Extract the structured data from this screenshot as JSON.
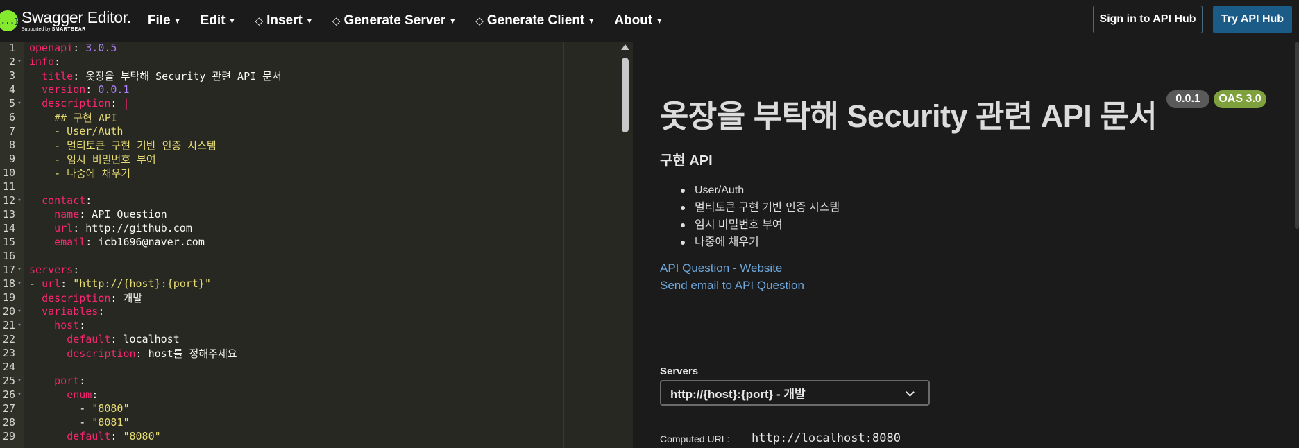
{
  "app": {
    "logo_mark": "{...}",
    "title": "Swagger Editor.",
    "supported_by": "Supported by",
    "supported_brand": "SMARTBEAR"
  },
  "menu": {
    "items": [
      {
        "label": "File",
        "gem": false
      },
      {
        "label": "Edit",
        "gem": false
      },
      {
        "label": "Insert",
        "gem": true
      },
      {
        "label": "Generate Server",
        "gem": true
      },
      {
        "label": "Generate Client",
        "gem": true
      },
      {
        "label": "About",
        "gem": false
      }
    ],
    "caret": "▾",
    "gem_glyph": "💎"
  },
  "header_buttons": {
    "sign_in": "Sign in to API Hub",
    "try": "Try API Hub"
  },
  "editor": {
    "lines": [
      {
        "n": "1",
        "fold": "",
        "tokens": [
          [
            "k",
            "openapi"
          ],
          [
            "p",
            ": "
          ],
          [
            "n",
            "3.0.5"
          ]
        ]
      },
      {
        "n": "2",
        "fold": "▾",
        "tokens": [
          [
            "k",
            "info"
          ],
          [
            "p",
            ":"
          ]
        ]
      },
      {
        "n": "3",
        "fold": "",
        "tokens": [
          [
            "p",
            "  "
          ],
          [
            "k",
            "title"
          ],
          [
            "p",
            ": 옷장을 부탁해 Security 관련 API 문서"
          ]
        ]
      },
      {
        "n": "4",
        "fold": "",
        "tokens": [
          [
            "p",
            "  "
          ],
          [
            "k",
            "version"
          ],
          [
            "p",
            ": "
          ],
          [
            "n",
            "0.0.1"
          ]
        ]
      },
      {
        "n": "5",
        "fold": "▾",
        "tokens": [
          [
            "p",
            "  "
          ],
          [
            "k",
            "description"
          ],
          [
            "p",
            ": "
          ],
          [
            "k",
            "|"
          ]
        ]
      },
      {
        "n": "6",
        "fold": "",
        "tokens": [
          [
            "s",
            "    ## 구현 API"
          ]
        ]
      },
      {
        "n": "7",
        "fold": "",
        "tokens": [
          [
            "s",
            "    - User/Auth"
          ]
        ]
      },
      {
        "n": "8",
        "fold": "",
        "tokens": [
          [
            "s",
            "    - 멀티토큰 구현 기반 인증 시스템"
          ]
        ]
      },
      {
        "n": "9",
        "fold": "",
        "tokens": [
          [
            "s",
            "    - 임시 비밀번호 부여"
          ]
        ]
      },
      {
        "n": "10",
        "fold": "",
        "tokens": [
          [
            "s",
            "    - 나중에 채우기"
          ]
        ]
      },
      {
        "n": "11",
        "fold": "",
        "tokens": [
          [
            "p",
            ""
          ]
        ]
      },
      {
        "n": "12",
        "fold": "▾",
        "tokens": [
          [
            "p",
            "  "
          ],
          [
            "k",
            "contact"
          ],
          [
            "p",
            ":"
          ]
        ]
      },
      {
        "n": "13",
        "fold": "",
        "tokens": [
          [
            "p",
            "    "
          ],
          [
            "k",
            "name"
          ],
          [
            "p",
            ": API Question"
          ]
        ]
      },
      {
        "n": "14",
        "fold": "",
        "tokens": [
          [
            "p",
            "    "
          ],
          [
            "k",
            "url"
          ],
          [
            "p",
            ": http://github.com"
          ]
        ]
      },
      {
        "n": "15",
        "fold": "",
        "tokens": [
          [
            "p",
            "    "
          ],
          [
            "k",
            "email"
          ],
          [
            "p",
            ": icb1696@naver.com"
          ]
        ]
      },
      {
        "n": "16",
        "fold": "",
        "tokens": [
          [
            "p",
            ""
          ]
        ]
      },
      {
        "n": "17",
        "fold": "▾",
        "tokens": [
          [
            "k",
            "servers"
          ],
          [
            "p",
            ":"
          ]
        ]
      },
      {
        "n": "18",
        "fold": "▾",
        "tokens": [
          [
            "p",
            "- "
          ],
          [
            "k",
            "url"
          ],
          [
            "p",
            ": "
          ],
          [
            "s",
            "\"http://{host}:{port}\""
          ]
        ]
      },
      {
        "n": "19",
        "fold": "",
        "tokens": [
          [
            "p",
            "  "
          ],
          [
            "k",
            "description"
          ],
          [
            "p",
            ": 개발"
          ]
        ]
      },
      {
        "n": "20",
        "fold": "▾",
        "tokens": [
          [
            "p",
            "  "
          ],
          [
            "k",
            "variables"
          ],
          [
            "p",
            ":"
          ]
        ]
      },
      {
        "n": "21",
        "fold": "▾",
        "tokens": [
          [
            "p",
            "    "
          ],
          [
            "k",
            "host"
          ],
          [
            "p",
            ":"
          ]
        ]
      },
      {
        "n": "22",
        "fold": "",
        "tokens": [
          [
            "p",
            "      "
          ],
          [
            "k",
            "default"
          ],
          [
            "p",
            ": localhost"
          ]
        ]
      },
      {
        "n": "23",
        "fold": "",
        "tokens": [
          [
            "p",
            "      "
          ],
          [
            "k",
            "description"
          ],
          [
            "p",
            ": host를 정해주세요"
          ]
        ]
      },
      {
        "n": "24",
        "fold": "",
        "tokens": [
          [
            "p",
            ""
          ]
        ]
      },
      {
        "n": "25",
        "fold": "▾",
        "tokens": [
          [
            "p",
            "    "
          ],
          [
            "k",
            "port"
          ],
          [
            "p",
            ":"
          ]
        ]
      },
      {
        "n": "26",
        "fold": "▾",
        "tokens": [
          [
            "p",
            "      "
          ],
          [
            "k",
            "enum"
          ],
          [
            "p",
            ":"
          ]
        ]
      },
      {
        "n": "27",
        "fold": "",
        "tokens": [
          [
            "p",
            "        - "
          ],
          [
            "s",
            "\"8080\""
          ]
        ]
      },
      {
        "n": "28",
        "fold": "",
        "tokens": [
          [
            "p",
            "        - "
          ],
          [
            "s",
            "\"8081\""
          ]
        ]
      },
      {
        "n": "29",
        "fold": "",
        "tokens": [
          [
            "p",
            "      "
          ],
          [
            "k",
            "default"
          ],
          [
            "p",
            ": "
          ],
          [
            "s",
            "\"8080\""
          ]
        ]
      }
    ]
  },
  "preview": {
    "title": "옷장을 부탁해 Security 관련 API 문서",
    "version_badge": "0.0.1",
    "oas_badge": "OAS 3.0",
    "description_heading": "구현 API",
    "description_items": [
      "User/Auth",
      "멀티토큰 구현 기반 인증 시스템",
      "임시 비밀번호 부여",
      "나중에 채우기"
    ],
    "contact_website_link": "API Question - Website",
    "contact_email_link": "Send email to API Question",
    "servers_label": "Servers",
    "servers_selected": "http://{host}:{port} - 개발",
    "computed_url_label": "Computed URL:",
    "computed_url_value": "http://localhost:8080"
  },
  "colors": {
    "accent_green": "#85ea2d",
    "try_button": "#1b5b88",
    "oas_badge": "#7ea13e",
    "link": "#6fa8dc"
  }
}
